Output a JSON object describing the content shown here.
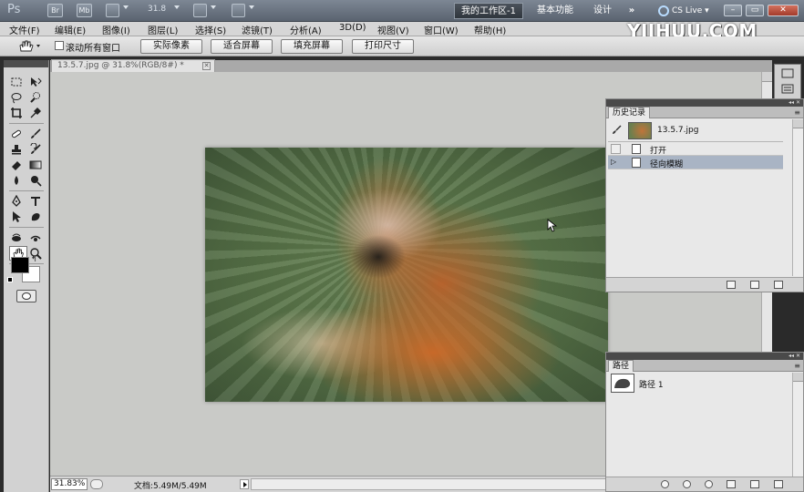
{
  "app": {
    "logo": "Ps",
    "bridge_label": "Br",
    "mini_bridge_label": "Mb",
    "zoom_level": "31.8",
    "workspace_active": "我的工作区-1",
    "workspace_basic": "基本功能",
    "workspace_design": "设计",
    "workspace_more": "»",
    "cs_live": "CS Live"
  },
  "menu": {
    "items": [
      "文件(F)",
      "编辑(E)",
      "图像(I)",
      "图层(L)",
      "选择(S)",
      "滤镜(T)",
      "分析(A)",
      "3D(D)",
      "视图(V)",
      "窗口(W)",
      "帮助(H)"
    ]
  },
  "brand": "YIIHUU.COM",
  "options": {
    "scroll_all_label": "滚动所有窗口",
    "actual_pixels": "实际像素",
    "fit_screen": "适合屏幕",
    "fill_screen": "填充屏幕",
    "print_size": "打印尺寸"
  },
  "document": {
    "tab_title": "13.5.7.jpg @ 31.8%(RGB/8#) *",
    "zoom": "31.83%",
    "doc_size": "文档:5.49M/5.49M"
  },
  "history": {
    "tab": "历史记录",
    "snapshot": "13.5.7.jpg",
    "steps": [
      "打开",
      "径向模糊"
    ]
  },
  "paths": {
    "tab": "路径",
    "items": [
      "路径 1"
    ]
  },
  "colors": {
    "foreground": "#000000",
    "background": "#ffffff"
  }
}
